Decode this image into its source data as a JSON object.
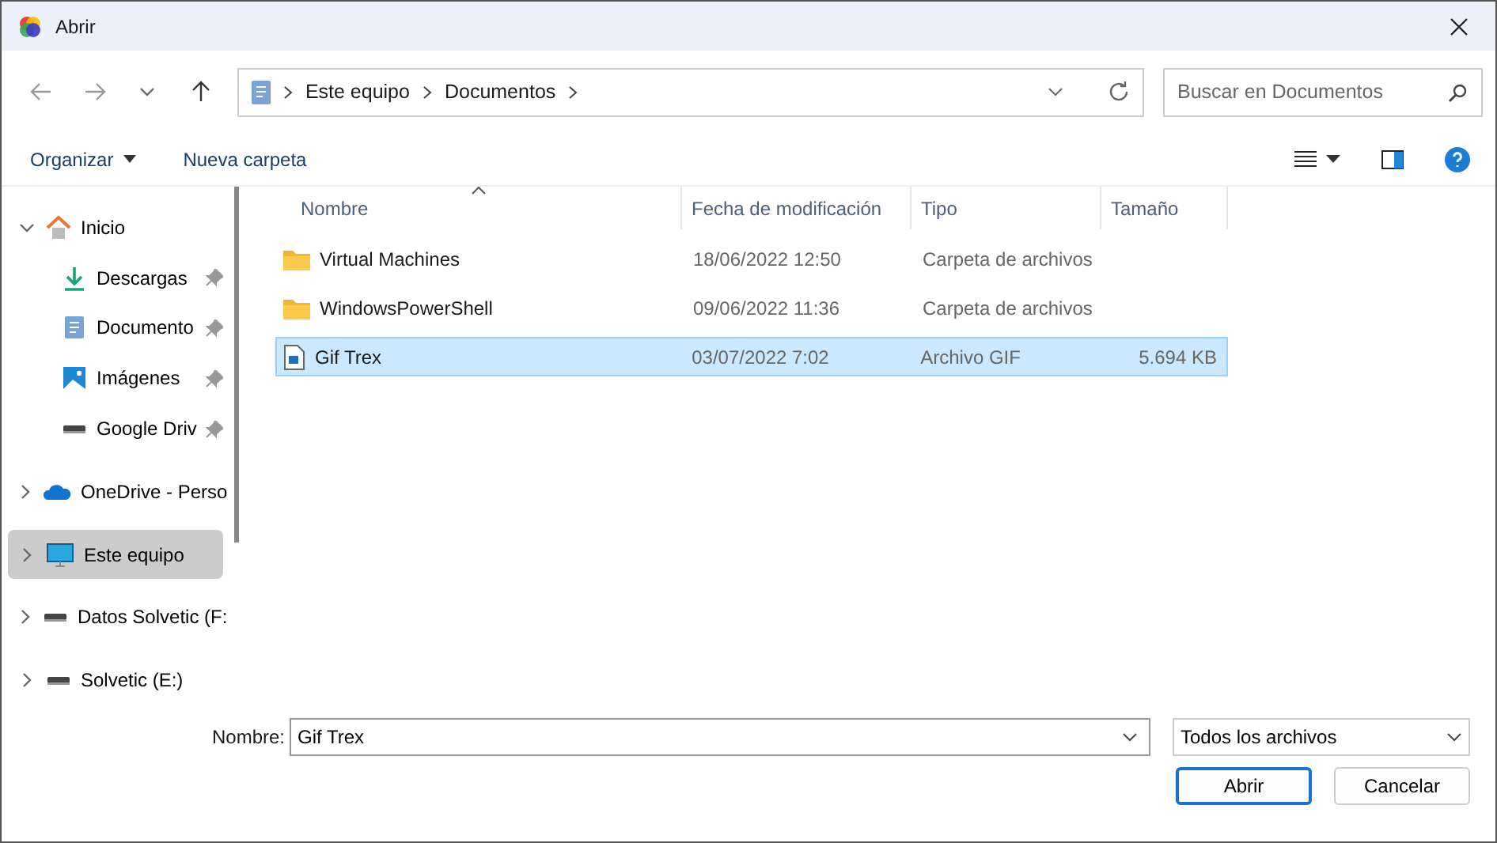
{
  "window": {
    "title": "Abrir"
  },
  "address_bar": {
    "crumbs": [
      "Este equipo",
      "Documentos"
    ]
  },
  "search": {
    "placeholder": "Buscar en Documentos"
  },
  "toolbar": {
    "organize": "Organizar",
    "new_folder": "Nueva carpeta"
  },
  "sidebar": {
    "items": [
      {
        "label": "Inicio",
        "kind": "home",
        "expanded": true,
        "selected": false,
        "children": [
          {
            "label": "Descargas",
            "kind": "download",
            "pinned": true,
            "selected": false
          },
          {
            "label": "Documento",
            "kind": "document",
            "pinned": true,
            "selected": false
          },
          {
            "label": "Imágenes",
            "kind": "image",
            "pinned": true,
            "selected": false
          },
          {
            "label": "Google Driv",
            "kind": "drive",
            "pinned": true,
            "selected": false
          }
        ]
      },
      {
        "label": "OneDrive - Perso",
        "kind": "cloud",
        "expanded": false,
        "selected": false
      },
      {
        "label": "Este equipo",
        "kind": "pc",
        "expanded": false,
        "selected": true
      },
      {
        "label": "Datos Solvetic (F:",
        "kind": "drive",
        "expanded": false,
        "selected": false
      },
      {
        "label": "Solvetic (E:)",
        "kind": "drive",
        "expanded": false,
        "selected": false
      }
    ]
  },
  "table": {
    "columns": [
      {
        "label": "Nombre",
        "sorted": true
      },
      {
        "label": "Fecha de modificación",
        "sorted": false
      },
      {
        "label": "Tipo",
        "sorted": false
      },
      {
        "label": "Tamaño",
        "sorted": false
      }
    ],
    "rows": [
      {
        "name": "Virtual Machines",
        "date": "18/06/2022 12:50",
        "type": "Carpeta de archivos",
        "kind": "folder",
        "selected": false
      },
      {
        "name": "WindowsPowerShell",
        "date": "09/06/2022 11:36",
        "type": "Carpeta de archivos",
        "kind": "folder",
        "selected": false
      },
      {
        "name": "Gif Trex",
        "date": "03/07/2022 7:02",
        "type": "Archivo GIF",
        "size": "5.694 KB",
        "kind": "image",
        "selected": true
      }
    ]
  },
  "footer": {
    "name_label": "Nombre:",
    "name_value": "Gif Trex",
    "filter": "Todos los archivos",
    "open": "Abrir",
    "cancel": "Cancelar"
  }
}
